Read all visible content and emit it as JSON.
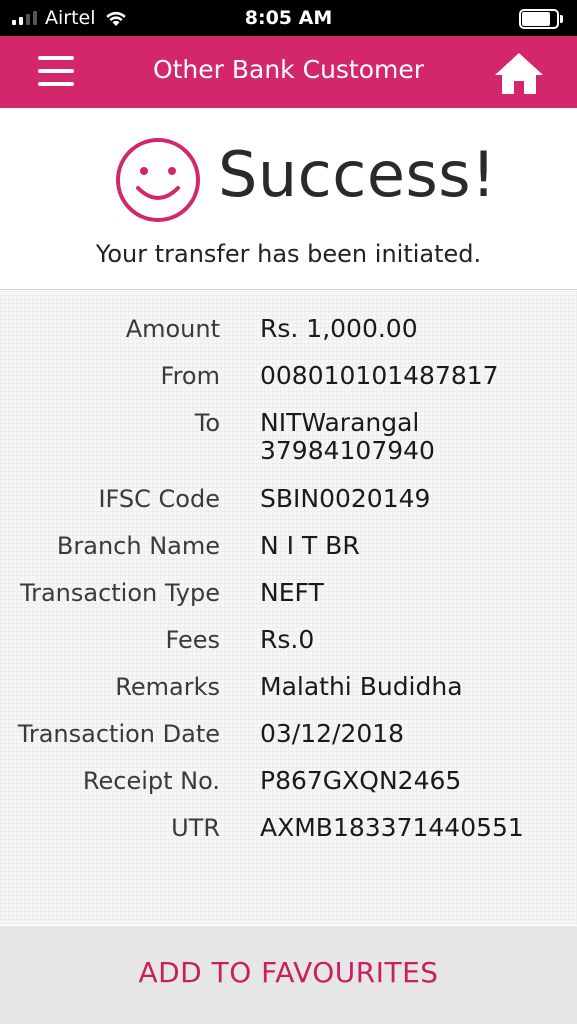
{
  "status_bar": {
    "carrier": "Airtel",
    "time": "8:05 AM"
  },
  "nav": {
    "title": "Other Bank Customer",
    "menu_icon": "hamburger-menu-icon",
    "home_icon": "home-icon",
    "bar_color": "#d4266a"
  },
  "success": {
    "icon": "smiley-icon",
    "title": "Success!",
    "subtitle": "Your transfer has been initiated."
  },
  "details": [
    {
      "label": "Amount",
      "value": "Rs. 1,000.00"
    },
    {
      "label": "From",
      "value": "008010101487817"
    },
    {
      "label": "To",
      "value": "NITWarangal",
      "value2": "37984107940"
    },
    {
      "label": "IFSC Code",
      "value": "SBIN0020149"
    },
    {
      "label": "Branch Name",
      "value": "N I T BR"
    },
    {
      "label": "Transaction Type",
      "value": "NEFT"
    },
    {
      "label": "Fees",
      "value": "Rs.0"
    },
    {
      "label": "Remarks",
      "value": "Malathi Budidha"
    },
    {
      "label": "Transaction Date",
      "value": "03/12/2018"
    },
    {
      "label": "Receipt No.",
      "value": "P867GXQN2465"
    },
    {
      "label": "UTR",
      "value": "AXMB183371440551"
    }
  ],
  "footer": {
    "favourites_label": "ADD TO FAVOURITES",
    "accent_color": "#c8205f"
  }
}
